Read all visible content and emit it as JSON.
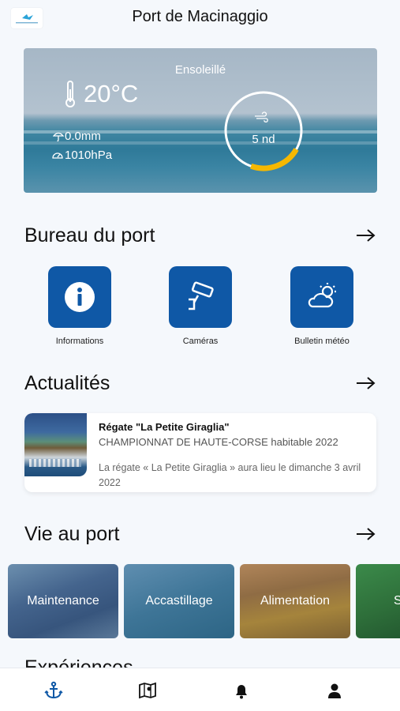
{
  "header": {
    "title": "Port de Macinaggio",
    "logo_icon": "port-logo"
  },
  "weather": {
    "condition": "Ensoleillé",
    "temperature": "20°C",
    "rain": "0.0mm",
    "pressure": "1010hPa",
    "wind": "5 nd",
    "wind_gauge_fraction": 0.22,
    "gauge_color": "#f5b800"
  },
  "bureau": {
    "title": "Bureau du port",
    "tiles": [
      {
        "label": "Informations",
        "icon": "info-icon"
      },
      {
        "label": "Caméras",
        "icon": "camera-icon"
      },
      {
        "label": "Bulletin météo",
        "icon": "weather-cloud-icon"
      }
    ],
    "tile_color": "#0f58a6"
  },
  "news": {
    "title": "Actualités",
    "item": {
      "title": "Régate \"La Petite Giraglia\"",
      "subtitle": "CHAMPIONNAT DE HAUTE-CORSE habitable 2022",
      "body": "La régate « La Petite Giraglia » aura lieu le dimanche 3 avril 2022"
    }
  },
  "port_life": {
    "title": "Vie au port",
    "cards": [
      {
        "label": "Maintenance"
      },
      {
        "label": "Accastillage"
      },
      {
        "label": "Alimentation"
      },
      {
        "label": "S"
      }
    ]
  },
  "experiences": {
    "title": "Expériences"
  },
  "bottom_nav": {
    "items": [
      "anchor-icon",
      "map-icon",
      "bell-icon",
      "user-icon"
    ],
    "active_color": "#0f58a6"
  }
}
